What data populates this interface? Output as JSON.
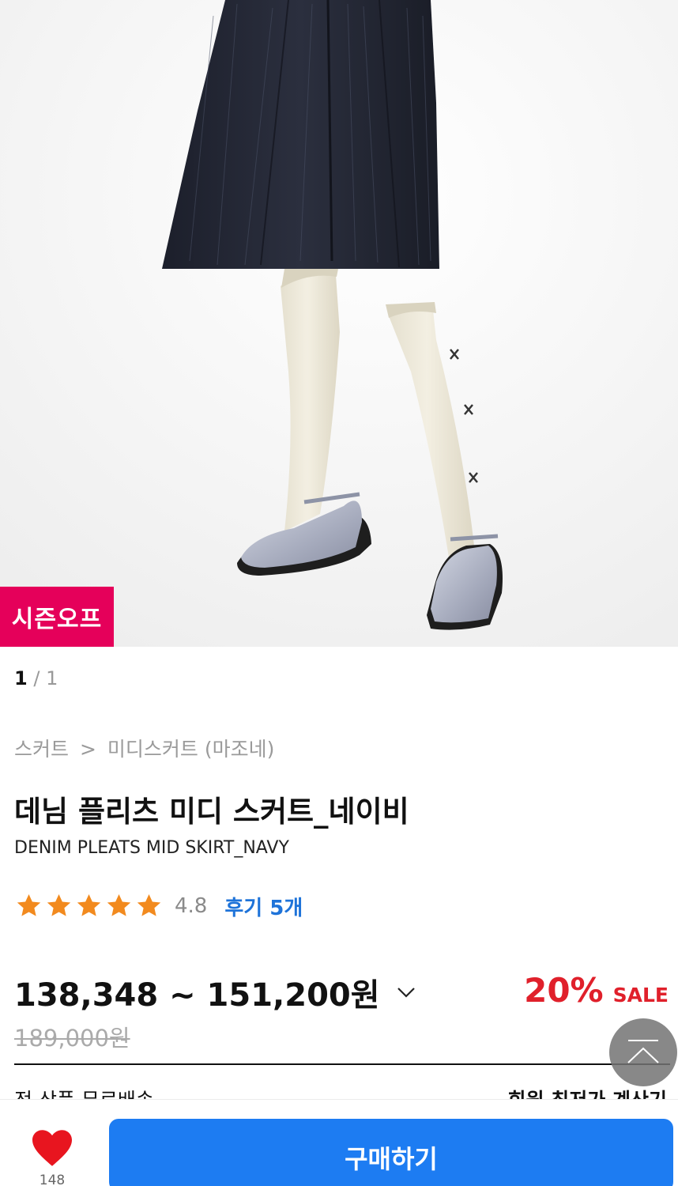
{
  "product_image": {
    "badge": "시즌오프"
  },
  "image_counter": {
    "current": "1",
    "separator": "/",
    "total": "1"
  },
  "breadcrumb": {
    "category": "스커트",
    "separator": ">",
    "subcategory": "미디스커트 (마조네)"
  },
  "product": {
    "title_ko": "데님 플리츠 미디 스커트_네이비",
    "title_en": "DENIM PLEATS MID SKIRT_NAVY"
  },
  "rating": {
    "stars": 5,
    "score": "4.8",
    "reviews_label": "후기 5개"
  },
  "price": {
    "range": "138,348 ~ 151,200원",
    "sale_percent": "20%",
    "sale_label": "SALE",
    "original": "189,000원"
  },
  "info_row": {
    "shipping": "전 상품 무료배송",
    "member_price": "회원 최저가 계산기"
  },
  "bottom_bar": {
    "like_count": "148",
    "buy_label": "구매하기"
  },
  "colors": {
    "badge": "#e5005a",
    "buy": "#1d7cf2",
    "sale": "#e0202b",
    "star": "#f28a1e",
    "heart": "#e8151f",
    "review_link": "#1e73d9"
  },
  "icons": {
    "star": "star-icon",
    "chevron": "chevron-down-icon",
    "top": "chevron-up-icon",
    "heart": "heart-icon"
  }
}
